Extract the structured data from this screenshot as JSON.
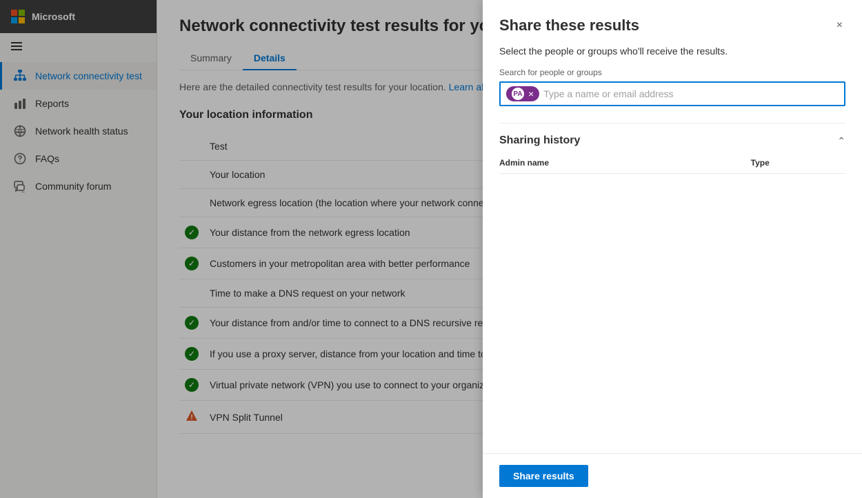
{
  "app": {
    "name": "Microsoft"
  },
  "sidebar": {
    "menu_icon": "≡",
    "items": [
      {
        "id": "network-connectivity",
        "label": "Network connectivity test",
        "icon": "network",
        "active": true
      },
      {
        "id": "reports",
        "label": "Reports",
        "icon": "chart",
        "active": false
      },
      {
        "id": "network-health",
        "label": "Network health status",
        "icon": "globe",
        "active": false
      },
      {
        "id": "faqs",
        "label": "FAQs",
        "icon": "question",
        "active": false
      },
      {
        "id": "community-forum",
        "label": "Community forum",
        "icon": "forum",
        "active": false
      }
    ]
  },
  "main": {
    "page_title": "Network connectivity test results for you",
    "tabs": [
      {
        "id": "summary",
        "label": "Summary",
        "active": false
      },
      {
        "id": "details",
        "label": "Details",
        "active": true
      }
    ],
    "description_prefix": "Here are the detailed connectivity test results for your location.",
    "description_link": "Learn about the tests",
    "section_title": "Your location information",
    "table_rows": [
      {
        "status": "none",
        "label": "Test"
      },
      {
        "status": "none",
        "label": "Your location"
      },
      {
        "status": "none",
        "label": "Network egress location (the location where your network connects to you"
      },
      {
        "status": "green",
        "label": "Your distance from the network egress location"
      },
      {
        "status": "green",
        "label": "Customers in your metropolitan area with better performance"
      },
      {
        "status": "none",
        "label": "Time to make a DNS request on your network"
      },
      {
        "status": "green",
        "label": "Your distance from and/or time to connect to a DNS recursive resolver"
      },
      {
        "status": "green",
        "label": "If you use a proxy server, distance from your location and time to connect"
      },
      {
        "status": "green",
        "label": "Virtual private network (VPN) you use to connect to your organization"
      },
      {
        "status": "warning",
        "label": "VPN Split Tunnel"
      }
    ]
  },
  "panel": {
    "title": "Share these results",
    "description": "Select the people or groups who'll receive the results.",
    "close_icon": "×",
    "search_label": "Search for people or groups",
    "tag_initials": "PA",
    "tag_remove_label": "×",
    "search_placeholder": "Type a name or email address",
    "sharing_history_title": "Sharing history",
    "sharing_history_collapsed": false,
    "table_headers": {
      "admin_name": "Admin name",
      "type": "Type"
    },
    "table_rows": [],
    "share_button_label": "Share results"
  }
}
